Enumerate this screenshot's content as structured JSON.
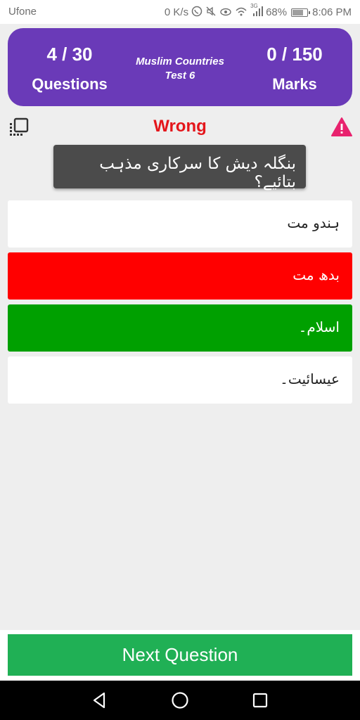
{
  "status_bar": {
    "carrier": "Ufone",
    "speed": "0 K/s",
    "network": "3G",
    "battery_percent": "68%",
    "battery_level": 0.68,
    "time": "8:06 PM",
    "icons": [
      "phone-icon",
      "mute-icon",
      "eye-icon",
      "wifi-icon",
      "signal-icon",
      "battery-icon"
    ]
  },
  "header": {
    "questions_count": "4 / 30",
    "questions_label": "Questions",
    "quiz_title_line1": "Muslim Countries",
    "quiz_title_line2": "Test 6",
    "marks_count": "0 / 150",
    "marks_label": "Marks",
    "background_color": "#6a3ab8"
  },
  "feedback": {
    "text": "Wrong",
    "color": "#e4161b"
  },
  "question": {
    "text": "بنگلہ دیش کا سرکاری مذہب بتائیے؟"
  },
  "options": [
    {
      "text": "ہندو مت",
      "state": "neutral",
      "color": "#ffffff"
    },
    {
      "text": "بدھ مت",
      "state": "wrong",
      "color": "#ff0000"
    },
    {
      "text": "اسلام۔",
      "state": "correct",
      "color": "#00a000"
    },
    {
      "text": "عیسائیت۔",
      "state": "neutral",
      "color": "#ffffff"
    }
  ],
  "next_button": {
    "label": "Next Question",
    "color": "#20b055"
  },
  "nav_bar": {
    "icons": [
      "back-icon",
      "home-icon",
      "recents-icon"
    ]
  }
}
